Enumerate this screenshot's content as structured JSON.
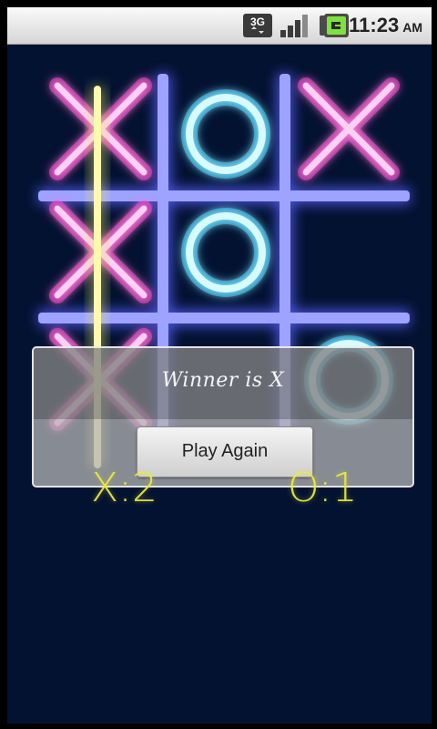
{
  "status_bar": {
    "network_label": "3G",
    "time": "11:23",
    "ampm": "AM",
    "icons": [
      "3g-data-icon",
      "signal-strength-icon",
      "battery-charging-icon"
    ]
  },
  "board": {
    "cells": [
      "X",
      "O",
      "X",
      "X",
      "O",
      "",
      "X",
      "",
      "O"
    ],
    "winning_line": "left-column"
  },
  "dialog": {
    "title": "Winner is X",
    "button_label": "Play Again"
  },
  "scores": {
    "x": "X:2",
    "o": "O:1"
  },
  "colors": {
    "background": "#031231",
    "grid": "#7f86ff",
    "x_mark": "#ff3dcf",
    "o_mark": "#46f0ff",
    "win_line": "#fdf78a",
    "score_text": "#eaeb3c"
  }
}
